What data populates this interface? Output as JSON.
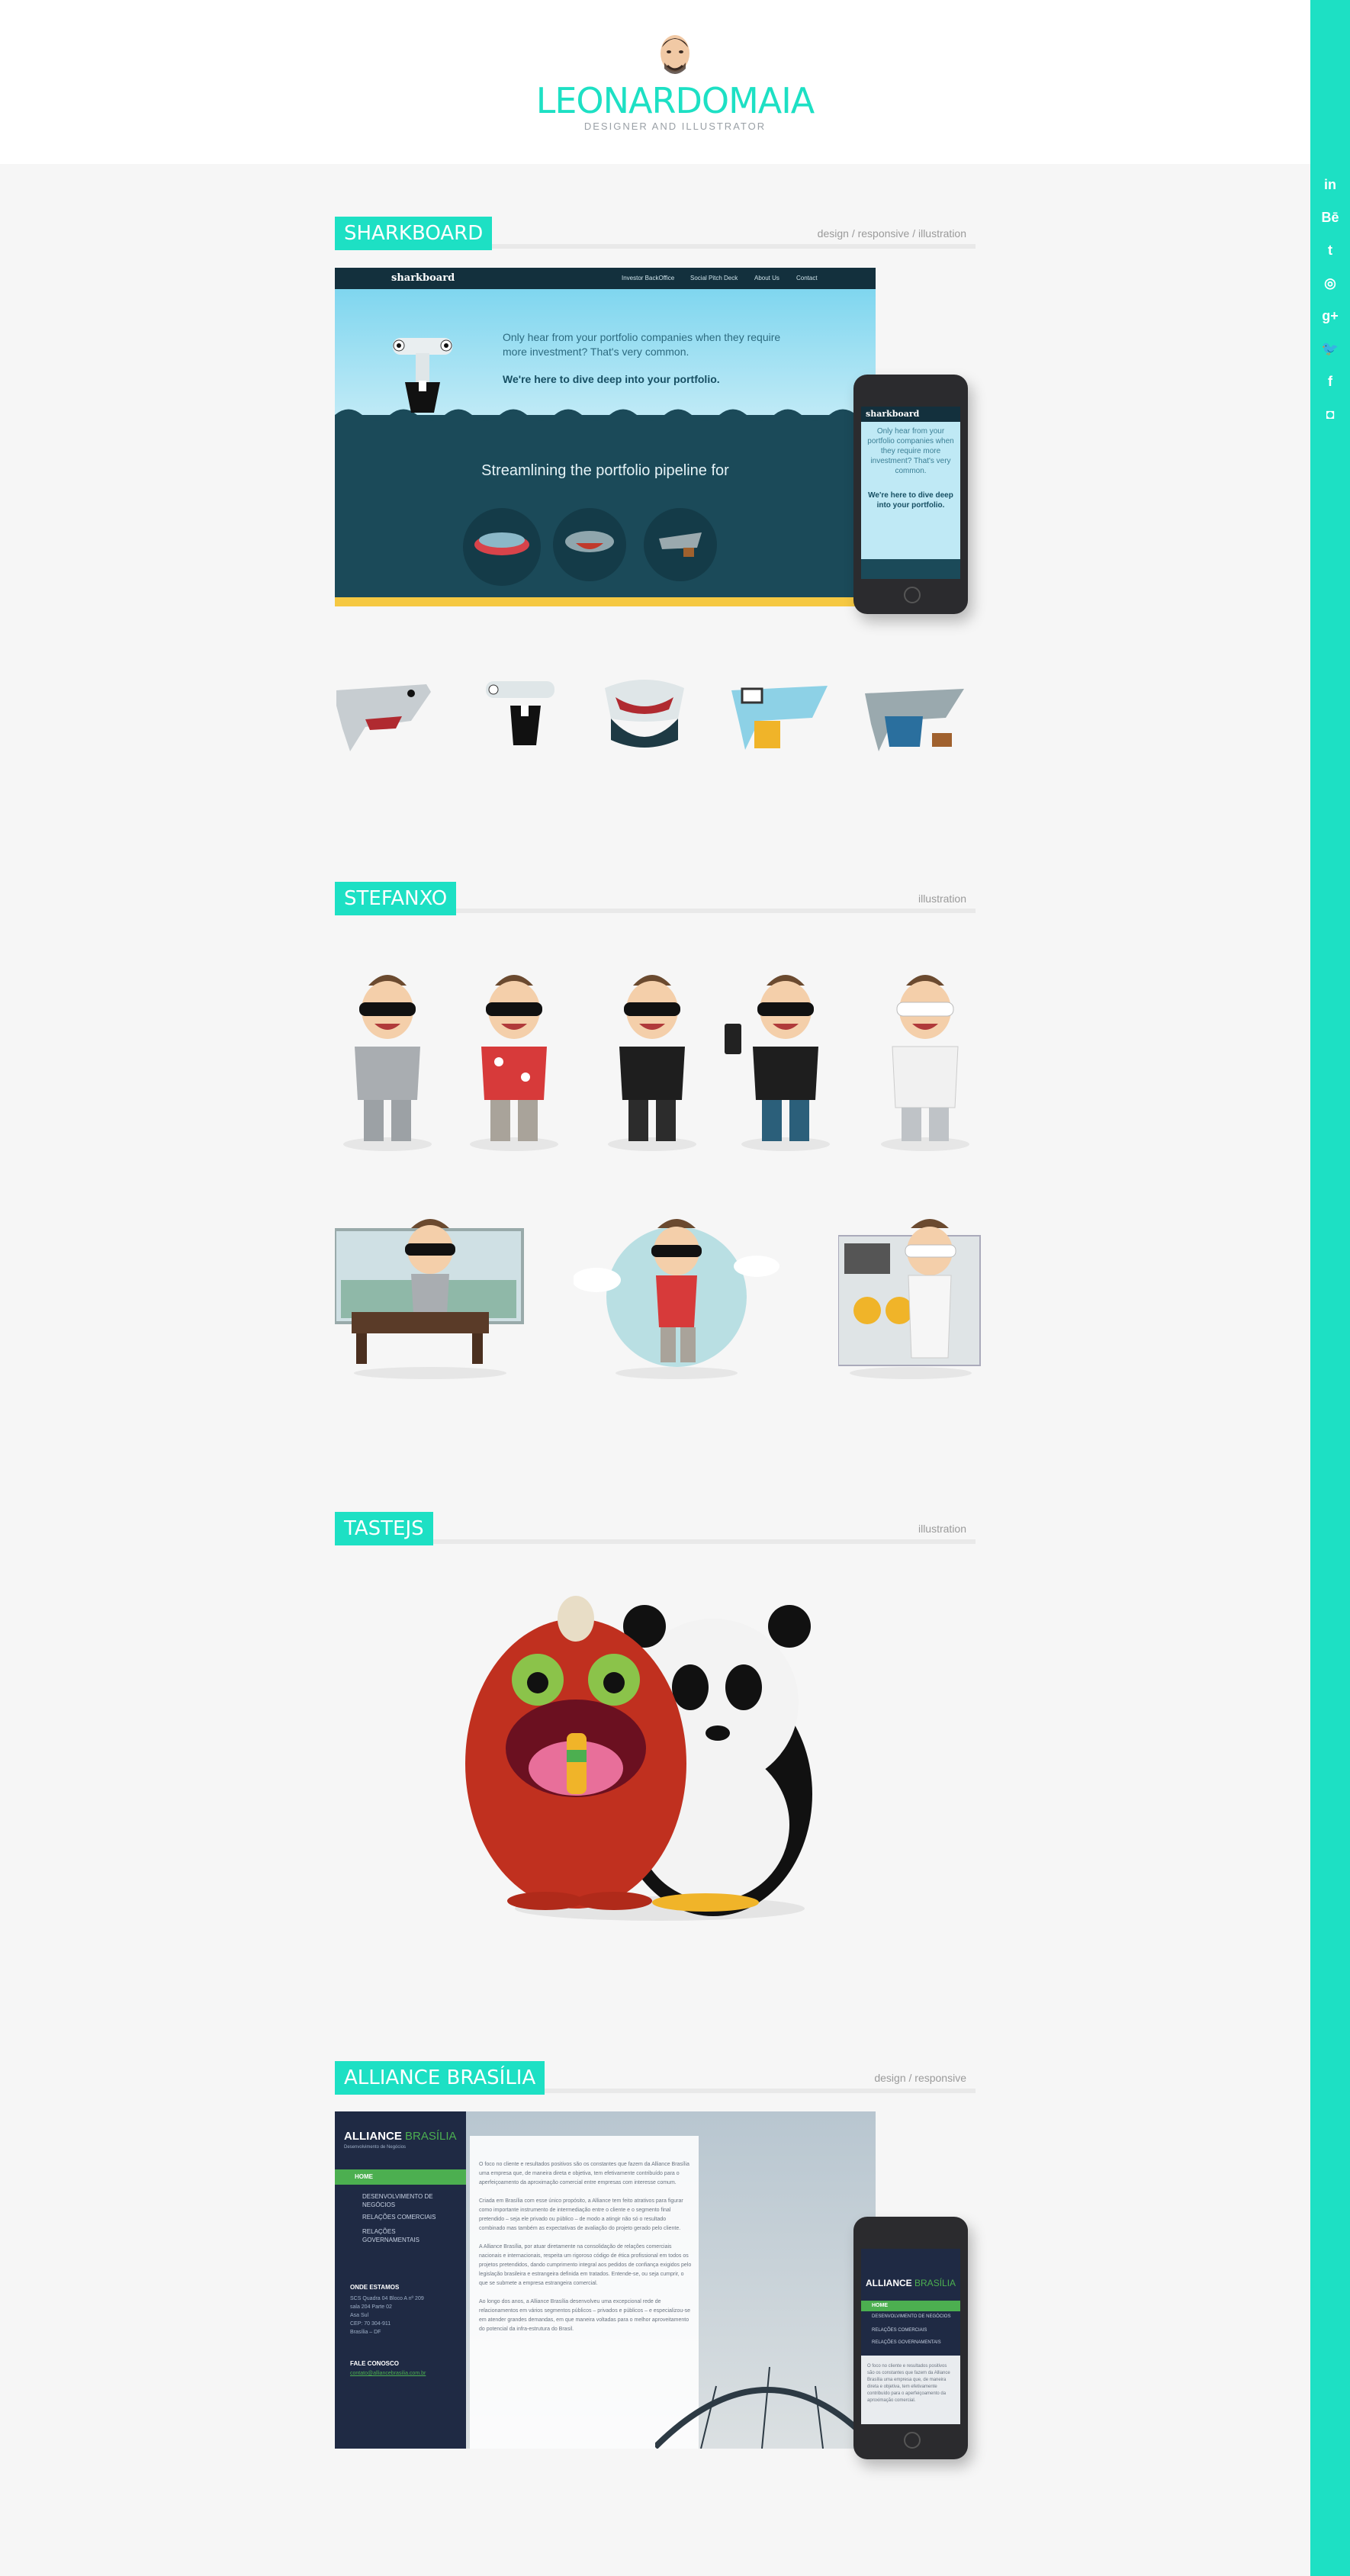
{
  "brand": {
    "first": "LEONARDO",
    "second": "MAIA",
    "tagline": "DESIGNER AND ILLUSTRATOR"
  },
  "social": [
    {
      "icon": "linkedin-icon",
      "glyph": "in"
    },
    {
      "icon": "behance-icon",
      "glyph": "Bē"
    },
    {
      "icon": "tumblr-icon",
      "glyph": "t"
    },
    {
      "icon": "dribbble-icon",
      "glyph": "◎"
    },
    {
      "icon": "googleplus-icon",
      "glyph": "g+"
    },
    {
      "icon": "twitter-icon",
      "glyph": "🐦"
    },
    {
      "icon": "facebook-icon",
      "glyph": "f"
    },
    {
      "icon": "instagram-icon",
      "glyph": "◘"
    }
  ],
  "sections": {
    "sharkboard": {
      "title": "SHARKBOARD",
      "tags": "design / responsive / illustration",
      "site_logo": "sharkboard",
      "nav": [
        "Investor BackOffice",
        "Social Pitch Deck",
        "About Us",
        "Contact"
      ],
      "hero_text": "Only hear from your portfolio companies when they require more investment? That's very common.",
      "hero_bold": "We're here to dive deep into your portfolio.",
      "streamline": "Streamlining the portfolio pipeline for",
      "phone_logo": "sharkboard",
      "phone_text": "Only hear from your portfolio companies when they require more investment? That's very common.",
      "phone_bold": "We're here to dive deep into your portfolio."
    },
    "stefanxo": {
      "title": "STEFANXO",
      "tags": "illustration"
    },
    "tastejs": {
      "title": "TASTEJS",
      "tags": "illustration"
    },
    "alliance": {
      "title": "ALLIANCE BRASÍLIA",
      "tags": "design / responsive",
      "logo_a": "ALLIANCE",
      "logo_b": "BRASÍLIA",
      "logo_sub": "Desenvolvimento de Negócios",
      "menu": [
        "HOME",
        "DESENVOLVIMENTO DE NEGÓCIOS",
        "RELAÇÕES COMERCIAIS",
        "RELAÇÕES GOVERNAMENTAIS"
      ],
      "contact_title": "ONDE ESTAMOS",
      "contact_lines": [
        "SCS Quadra 04 Bloco A nº 209",
        "sala 204 Parte 02",
        "Asa Sul",
        "CEP: 70 304-911",
        "Brasília – DF"
      ],
      "fale_title": "FALE CONOSCO",
      "fale_email": "contato@alliancebrasilia.com.br",
      "paragraphs": [
        "O foco no cliente e resultados positivos são os constantes que fazem da Alliance Brasília uma empresa que, de maneira direta e objetiva, tem efetivamente contribuído para o aperfeiçoamento da aproximação comercial entre empresas com interesse comum.",
        "Criada em Brasília com esse único propósito, a Alliance tem feito atrativos para figurar como importante instrumento de intermediação entre o cliente e o segmento final pretendido – seja ele privado ou público – de modo a atingir não só o resultado combinado mas também as expectativas de avaliação do projeto gerado pelo cliente.",
        "A Alliance Brasília, por atuar diretamente na consolidação de relações comerciais nacionais e internacionais, respeita um rigoroso código de ética profissional em todos os projetos pretendidos, dando cumprimento integral aos pedidos de confiança exigidos pelo legislação brasileira e estrangeira definida em tratados. Entende-se, ou seja cumprir, o que se submete a empresa estrangeira comercial.",
        "Ao longo dos anos, a Alliance Brasília desenvolveu uma excepcional rede de relacionamentos em vários segmentos públicos – privados e públicos – e especializou-se em atender grandes demandas, em que maneira voltadas para o melhor aproveitamento do potencial da infra-estrutura do Brasil."
      ],
      "phone_logo_a": "ALLIANCE",
      "phone_logo_b": "BRASÍLIA",
      "phone_menu": [
        "HOME",
        "DESENVOLVIMENTO DE NEGÓCIOS",
        "RELAÇÕES COMERCIAIS",
        "RELAÇÕES GOVERNAMENTAIS"
      ],
      "phone_text": "O foco no cliente e resultados positivos são os constantes que fazem da Alliance Brasília uma empresa que, de maneira direta e objetiva, tem efetivamente contribuído para o aperfeiçoamento da aproximação comercial."
    }
  },
  "colors": {
    "accent": "#1de0c4",
    "sea_top": "#7fd6ef",
    "sea_deep": "#1b4a59",
    "navy": "#1f2a44",
    "green": "#4caf50"
  }
}
